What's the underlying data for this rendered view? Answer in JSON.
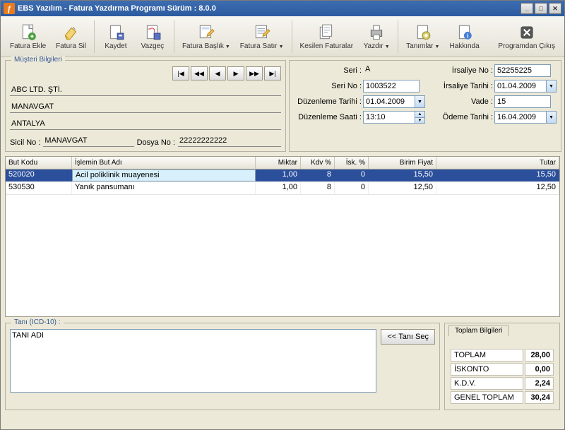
{
  "window": {
    "title": "EBS Yazılım - Fatura Yazdırma Programı Sürüm : 8.0.0"
  },
  "toolbar": {
    "fatura_ekle": "Fatura Ekle",
    "fatura_sil": "Fatura Sil",
    "kaydet": "Kaydet",
    "vazgec": "Vazgeç",
    "fatura_baslik": "Fatura Başlık",
    "fatura_satir": "Fatura Satır",
    "kesilen_faturalar": "Kesilen Faturalar",
    "yazdir": "Yazdır",
    "tanimlar": "Tanımlar",
    "hakkinda": "Hakkında",
    "cikis": "Programdan Çıkış"
  },
  "customer": {
    "legend": "Müşteri Bilgileri",
    "line1": "ABC LTD. ŞTİ.",
    "line2": "MANAVGAT",
    "line3": "ANTALYA",
    "sicil_label": "Sicil No :",
    "sicil": "MANAVGAT",
    "dosya_label": "Dosya No :",
    "dosya": "22222222222"
  },
  "header": {
    "seri_label": "Seri :",
    "seri": "A",
    "seri_no_label": "Seri No :",
    "seri_no": "1003522",
    "duz_tarih_label": "Düzenleme Tarihi :",
    "duz_tarih": "01.04.2009",
    "duz_saat_label": "Düzenleme Saati :",
    "duz_saat": "13:10",
    "irs_no_label": "İrsaliye No :",
    "irs_no": "52255225",
    "irs_tarih_label": "İrsaliye Tarihi :",
    "irs_tarih": "01.04.2009",
    "vade_label": "Vade :",
    "vade": "15",
    "odeme_label": "Ödeme Tarihi :",
    "odeme": "16.04.2009"
  },
  "grid": {
    "cols": {
      "but_kodu": "But Kodu",
      "islem": "İşlemin But Adı",
      "miktar": "Miktar",
      "kdv": "Kdv %",
      "isk": "İsk. %",
      "bf": "Birim Fiyat",
      "tutar": "Tutar"
    },
    "rows": [
      {
        "kod": "520020",
        "ad": "Acil poliklinik muayenesi",
        "mik": "1,00",
        "kdv": "8",
        "isk": "0",
        "bf": "15,50",
        "tut": "15,50"
      },
      {
        "kod": "530530",
        "ad": "Yanık pansumanı",
        "mik": "1,00",
        "kdv": "8",
        "isk": "0",
        "bf": "12,50",
        "tut": "12,50"
      }
    ]
  },
  "tani": {
    "legend": "Tanı (ICD-10) :",
    "value": "TANI ADI",
    "button": "<< Tanı Seç"
  },
  "totals": {
    "tab": "Toplam Bilgileri",
    "rows": {
      "toplam_l": "TOPLAM",
      "toplam_v": "28,00",
      "iskonto_l": "İSKONTO",
      "iskonto_v": "0,00",
      "kdv_l": "K.D.V.",
      "kdv_v": "2,24",
      "genel_l": "GENEL TOPLAM",
      "genel_v": "30,24"
    }
  }
}
